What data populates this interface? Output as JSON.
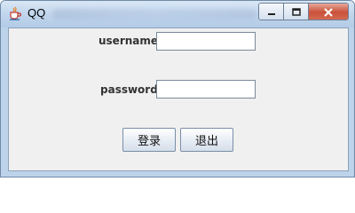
{
  "window": {
    "title": "QQ"
  },
  "form": {
    "username_label": "username",
    "username_value": "",
    "password_label": "password",
    "password_value": ""
  },
  "buttons": {
    "login_label": "登录",
    "exit_label": "退出"
  },
  "icons": {
    "app": "java-cup-icon",
    "minimize": "minimize-icon",
    "maximize": "maximize-icon",
    "close": "close-icon"
  },
  "colors": {
    "titlebar": "#c3d7ed",
    "content_bg": "#f0f0f0",
    "close_button": "#c9513a"
  }
}
